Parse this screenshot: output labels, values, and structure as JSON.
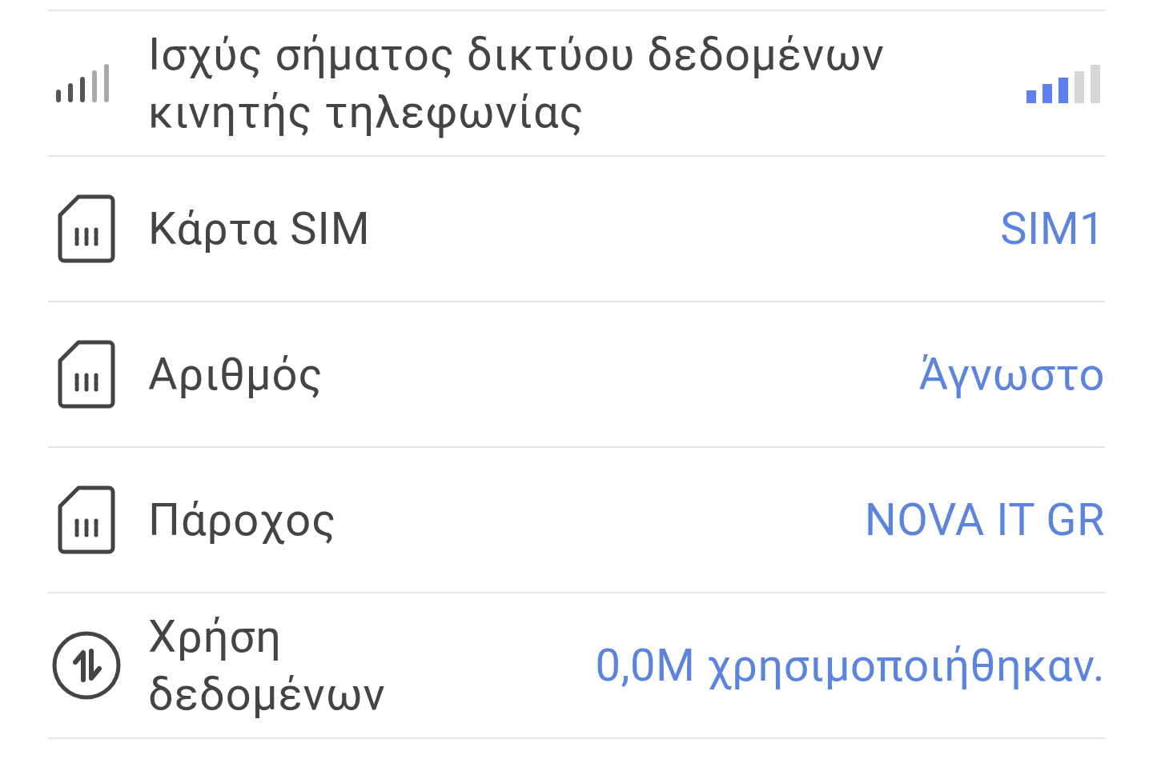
{
  "rows": [
    {
      "kind": "signal",
      "label": "Ισχύς σήματος δικτύου δεδομένων κινητής τηλεφωνίας"
    },
    {
      "kind": "sim",
      "label": "Κάρτα SIM",
      "value": "SIM1"
    },
    {
      "kind": "sim",
      "label": "Αριθμός",
      "value": "Άγνωστο"
    },
    {
      "kind": "sim",
      "label": "Πάροχος",
      "value": "NOVA IT GR"
    },
    {
      "kind": "data",
      "label": "Χρήση δεδομένων",
      "value": "0,0M χρησιμοποιήθηκαν."
    }
  ]
}
